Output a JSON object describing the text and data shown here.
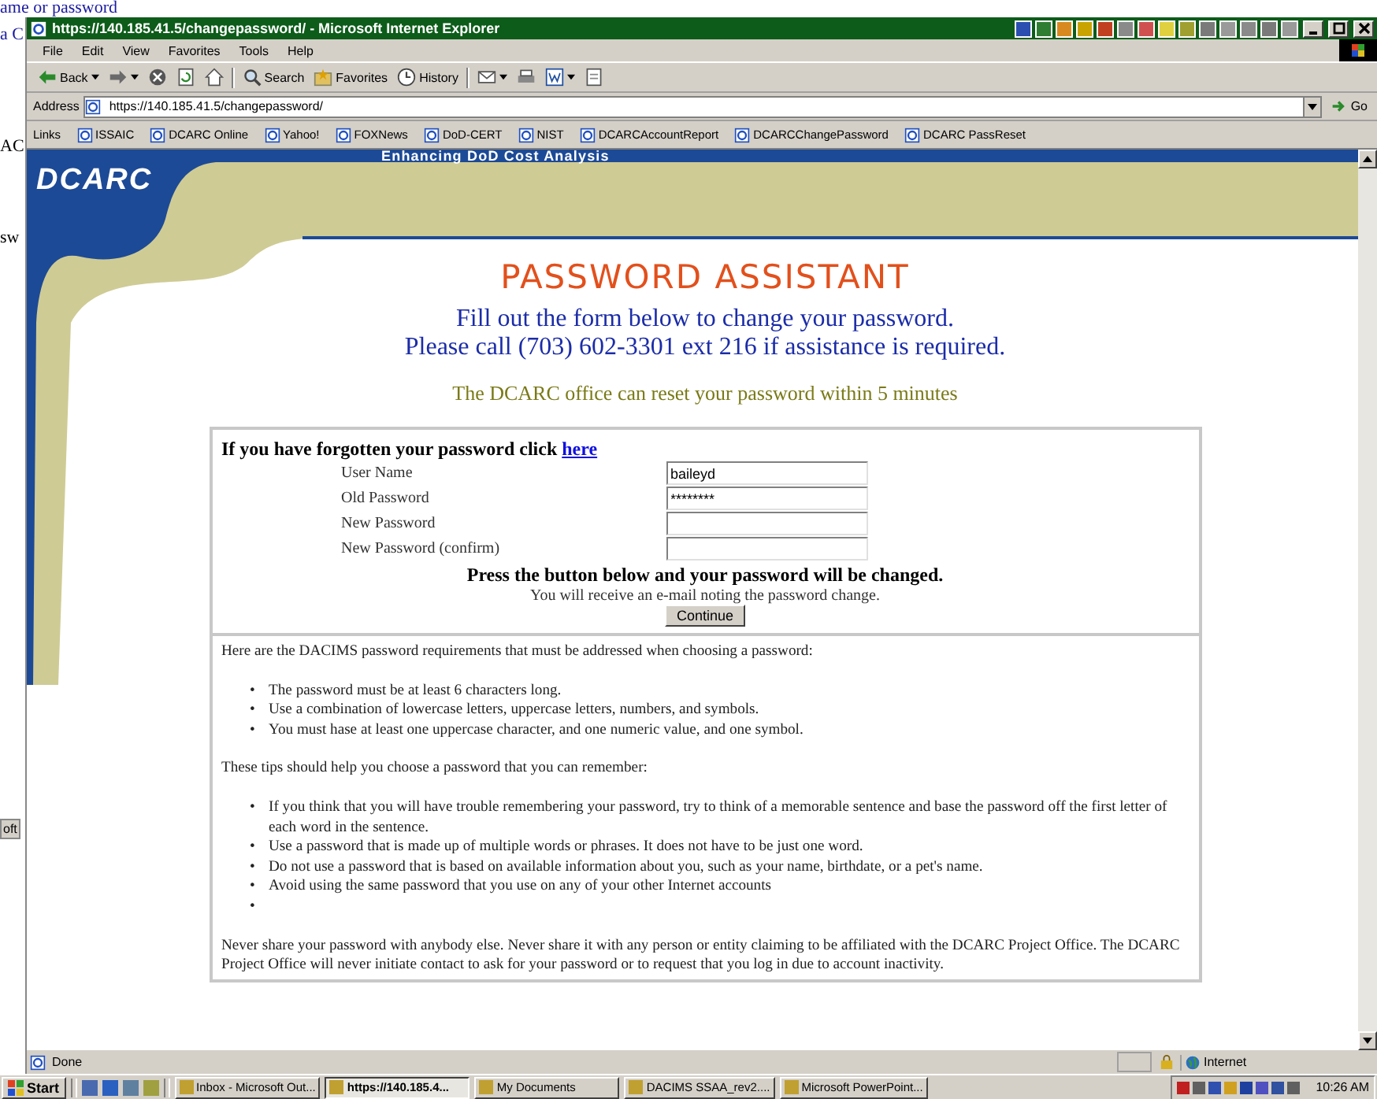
{
  "desktop": {
    "fragments": [
      {
        "text": "ame or password",
        "kind": "link"
      },
      {
        "text": "a C",
        "kind": "link"
      },
      {
        "text": "AC",
        "kind": "plain"
      },
      {
        "text": "sw",
        "kind": "plain"
      },
      {
        "text": "oft",
        "kind": "button"
      }
    ]
  },
  "window": {
    "title": "https://140.185.41.5/changepassword/ - Microsoft Internet Explorer"
  },
  "menu": [
    "File",
    "Edit",
    "View",
    "Favorites",
    "Tools",
    "Help"
  ],
  "toolbar": [
    {
      "kind": "back",
      "label": "Back",
      "dropdown": true
    },
    {
      "kind": "forward",
      "dropdown": true
    },
    {
      "kind": "stop",
      "dropdown": false
    },
    {
      "kind": "refresh",
      "dropdown": false
    },
    {
      "kind": "home",
      "dropdown": false
    },
    {
      "kind": "search",
      "label": "Search",
      "dropdown": false
    },
    {
      "kind": "favorites",
      "label": "Favorites",
      "dropdown": false
    },
    {
      "kind": "history",
      "label": "History",
      "dropdown": false
    },
    {
      "kind": "mail",
      "dropdown": true
    },
    {
      "kind": "print",
      "dropdown": false
    },
    {
      "kind": "edit",
      "dropdown": true
    },
    {
      "kind": "discuss",
      "dropdown": false
    }
  ],
  "address": {
    "label": "Address",
    "value": "https://140.185.41.5/changepassword/",
    "go": "Go"
  },
  "links": {
    "label": "Links",
    "items": [
      "ISSAIC",
      "DCARC Online",
      "Yahoo!",
      "FOXNews",
      "DoD-CERT",
      "NIST",
      "DCARCAccountReport",
      "DCARCChangePassword",
      "DCARC PassReset"
    ]
  },
  "page": {
    "tagline": "Enhancing DoD Cost Analysis",
    "logo": "DCARC",
    "heading": "PASSWORD ASSISTANT",
    "intro": [
      "Fill out the form below to change your password.",
      "Please call (703) 602-3301 ext 216 if assistance is required."
    ],
    "notice": "The DCARC office can reset your password within 5 minutes",
    "form": {
      "forgot_text": "If you have forgotten your password click",
      "forgot_link": "here",
      "fields": [
        {
          "label": "User Name",
          "value": "baileyd"
        },
        {
          "label": "Old Password",
          "value": "********"
        },
        {
          "label": "New Password"
        },
        {
          "label": "New Password (confirm)"
        }
      ],
      "instruction": "Press the button below and your password will be changed.",
      "note": "You will receive an e-mail noting the password change.",
      "submit": "Continue"
    },
    "requirements": {
      "intro": "Here are the DACIMS password requirements that must be addressed when choosing a password:",
      "rules": [
        "The password must be at least 6 characters long.",
        "Use a combination of lowercase letters, uppercase letters, numbers, and symbols.",
        "You must hase at least one uppercase character, and one numeric value, and one symbol."
      ],
      "tips_intro": "These tips should help you choose a password that you can remember:",
      "tips": [
        "If you think that you will have trouble remembering your password, try to think of a memorable sentence and base the password off the first letter of each word in the sentence.",
        "Use a password that is made up of multiple words or phrases. It does not have to be just one word.",
        "Do not use a password that is based on available information about you, such as your name, birthdate, or a pet's name.",
        "Avoid using the same password that you use on any of your other Internet accounts"
      ],
      "bullet": "•",
      "empty_bullet": true,
      "warning": "Never share your password with anybody else. Never share it with any person or entity claiming to be affiliated with the DCARC Project Office. The DCARC Project Office will never initiate contact to ask for your password or to request that you log in due to account inactivity."
    }
  },
  "status_bar": {
    "text": "Done",
    "zone": "Internet"
  },
  "taskbar": {
    "start": "Start",
    "tasks": [
      {
        "label": "Inbox - Microsoft Out...",
        "selected": false
      },
      {
        "label": "https://140.185.4...",
        "selected": true
      },
      {
        "label": "My Documents",
        "selected": false
      },
      {
        "label": "DACIMS SSAA_rev2....",
        "selected": false
      },
      {
        "label": "Microsoft PowerPoint...",
        "selected": false
      }
    ],
    "clock": "10:26 AM"
  }
}
